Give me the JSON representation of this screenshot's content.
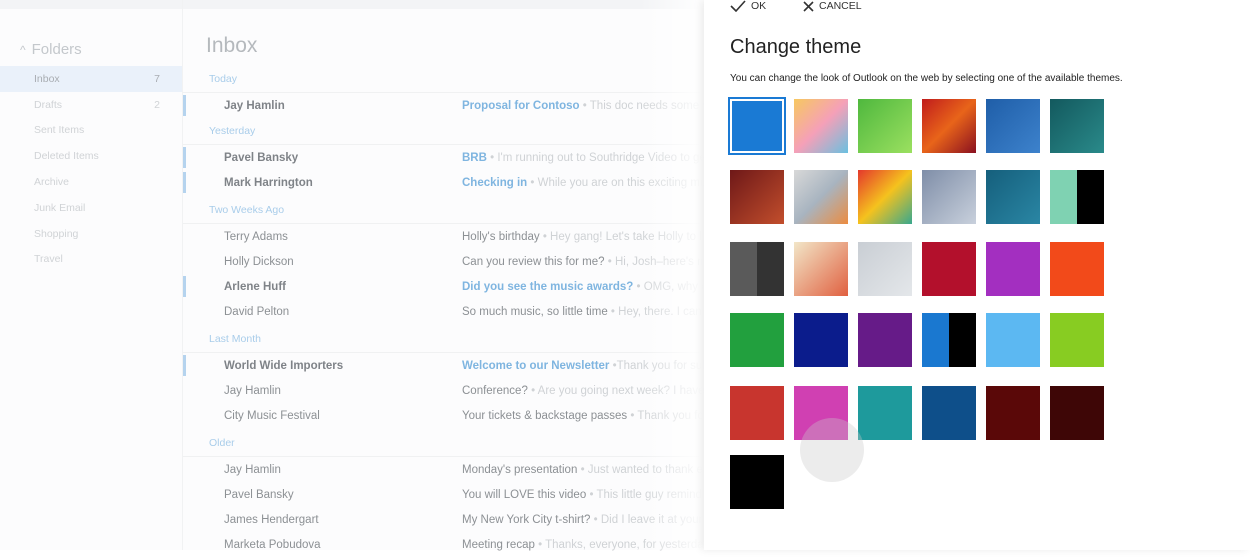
{
  "folders": {
    "heading": "Folders",
    "items": [
      {
        "label": "Inbox",
        "count": "7",
        "selected": true
      },
      {
        "label": "Drafts",
        "count": "2"
      },
      {
        "label": "Sent Items",
        "count": ""
      },
      {
        "label": "Deleted Items",
        "count": ""
      },
      {
        "label": "Archive",
        "count": ""
      },
      {
        "label": "Junk Email",
        "count": ""
      },
      {
        "label": "Shopping",
        "count": ""
      },
      {
        "label": "Travel",
        "count": ""
      }
    ]
  },
  "inbox": {
    "title": "Inbox",
    "groups": [
      {
        "label": "Today",
        "rows": [
          {
            "sender": "Jay Hamlin",
            "subject": "Proposal for Contoso",
            "preview": "• This doc needs some work",
            "unread": true
          }
        ]
      },
      {
        "label": "Yesterday",
        "rows": [
          {
            "sender": "Pavel Bansky",
            "subject": "BRB",
            "preview": "• I'm running out to Southridge Video to get",
            "unread": true
          },
          {
            "sender": "Mark Harrington",
            "subject": "Checking in",
            "preview": "• While you are on this exciting mu",
            "unread": true
          }
        ]
      },
      {
        "label": "Two Weeks Ago",
        "rows": [
          {
            "sender": "Terry Adams",
            "subject": "Holly's birthday",
            "preview": "• Hey gang! Let's take Holly to l"
          },
          {
            "sender": "Holly Dickson",
            "subject": "Can you review this for me?",
            "preview": "• Hi, Josh–here's my"
          },
          {
            "sender": "Arlene Huff",
            "subject": "Did you see the music awards?",
            "preview": "• OMG, why did",
            "unread": true
          },
          {
            "sender": "David Pelton",
            "subject": "So much music, so little time",
            "preview": "• Hey, there. I can't"
          }
        ]
      },
      {
        "label": "Last Month",
        "rows": [
          {
            "sender": "World Wide Importers",
            "subject": "Welcome to our Newsletter",
            "preview": "•Thank you for sub",
            "unread": true
          },
          {
            "sender": "Jay Hamlin",
            "subject": "Conference?",
            "preview": "• Are you going next week? I have"
          },
          {
            "sender": "City Music Festival",
            "subject": "Your tickets & backstage passes",
            "preview": "• Thank you for"
          }
        ]
      },
      {
        "label": "Older",
        "rows": [
          {
            "sender": "Jay Hamlin",
            "subject": "Monday's presentation",
            "preview": "• Just wanted to thank e"
          },
          {
            "sender": "Pavel Bansky",
            "subject": "You will LOVE this video",
            "preview": "• This little guy remind"
          },
          {
            "sender": "James Hendergart",
            "subject": "My New York City t-shirt?",
            "preview": "• Did I leave it at your"
          },
          {
            "sender": "Marketa Pobudova",
            "subject": "Meeting recap",
            "preview": "• Thanks, everyone, for yesterda"
          }
        ]
      }
    ]
  },
  "panel": {
    "ok_label": "OK",
    "ok_icon": "check-icon",
    "cancel_label": "CANCEL",
    "cancel_icon": "x-icon",
    "title": "Change theme",
    "description": "You can change the look of Outlook on the web by selecting one of the available themes.",
    "selected_index": 0,
    "themes": [
      {
        "name": "blue",
        "colors": [
          "#1a7ad4"
        ]
      },
      {
        "name": "sunshine",
        "colors": [
          "#f7c860",
          "#f5a0b8",
          "#6ac0e0"
        ]
      },
      {
        "name": "green-meadow",
        "colors": [
          "#4fb83e",
          "#9be060"
        ]
      },
      {
        "name": "red-abstract",
        "colors": [
          "#c01c1c",
          "#e8641a",
          "#8a1020"
        ]
      },
      {
        "name": "blueprint",
        "colors": [
          "#1f5ea8",
          "#3d82cc"
        ]
      },
      {
        "name": "circuit",
        "colors": [
          "#13595e",
          "#2a8a8a"
        ]
      },
      {
        "name": "wood",
        "colors": [
          "#6e1818",
          "#c24e2c"
        ]
      },
      {
        "name": "stripes",
        "colors": [
          "#d8d8d8",
          "#a8b4c0",
          "#ec8c40"
        ]
      },
      {
        "name": "geometric",
        "colors": [
          "#e4382c",
          "#f5c21e",
          "#38a88e"
        ]
      },
      {
        "name": "paper-plane",
        "colors": [
          "#7f8ea8",
          "#c8d0dc"
        ]
      },
      {
        "name": "teal-circles",
        "colors": [
          "#155f7c",
          "#2a86a4"
        ]
      },
      {
        "name": "mint-black",
        "colors": [
          "#7fd2b2",
          "#000000"
        ]
      },
      {
        "name": "dark-gray",
        "colors": [
          "#5a5a5a",
          "#333333"
        ]
      },
      {
        "name": "lucky-cat",
        "colors": [
          "#f2e6c8",
          "#e06040"
        ]
      },
      {
        "name": "snowflakes",
        "colors": [
          "#c9ced4",
          "#e4e7ea"
        ]
      },
      {
        "name": "crimson",
        "colors": [
          "#b3102c"
        ]
      },
      {
        "name": "purple",
        "colors": [
          "#a32fc0"
        ]
      },
      {
        "name": "orange",
        "colors": [
          "#f24a1a"
        ]
      },
      {
        "name": "green",
        "colors": [
          "#22a03e"
        ]
      },
      {
        "name": "navy",
        "colors": [
          "#0b1c8c"
        ]
      },
      {
        "name": "dark-purple",
        "colors": [
          "#661b88"
        ]
      },
      {
        "name": "blue-black",
        "colors": [
          "#1a78d0",
          "#000000"
        ]
      },
      {
        "name": "light-blue",
        "colors": [
          "#5cb8f2"
        ]
      },
      {
        "name": "lime",
        "colors": [
          "#88cc22"
        ]
      },
      {
        "name": "red",
        "colors": [
          "#c8352e"
        ]
      },
      {
        "name": "magenta",
        "colors": [
          "#d040b2"
        ]
      },
      {
        "name": "teal",
        "colors": [
          "#1e9a9c"
        ]
      },
      {
        "name": "dark-blue",
        "colors": [
          "#0e4f8a"
        ]
      },
      {
        "name": "maroon",
        "colors": [
          "#5a0808"
        ]
      },
      {
        "name": "dark-maroon",
        "colors": [
          "#3e0606"
        ]
      },
      {
        "name": "black",
        "colors": [
          "#000000"
        ]
      }
    ]
  }
}
